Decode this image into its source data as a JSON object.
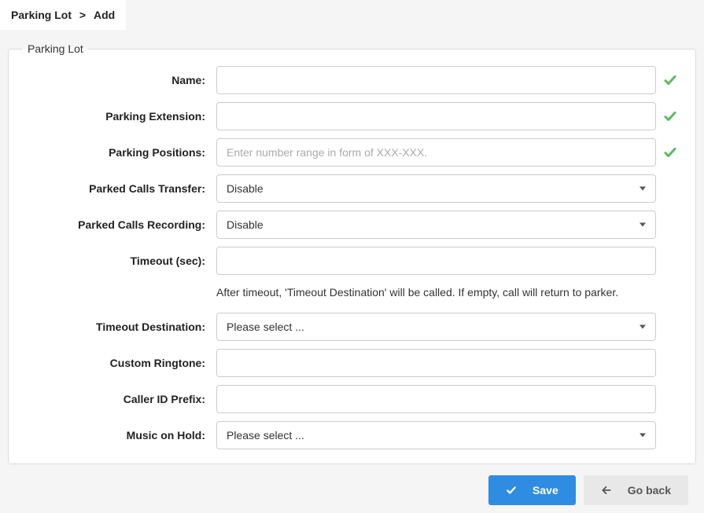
{
  "breadcrumb": {
    "root": "Parking Lot",
    "separator": "❯",
    "leaf": "Add"
  },
  "fieldset": {
    "legend": "Parking Lot"
  },
  "form": {
    "name": {
      "label": "Name:",
      "value": ""
    },
    "parking_extension": {
      "label": "Parking Extension:",
      "value": ""
    },
    "parking_positions": {
      "label": "Parking Positions:",
      "value": "",
      "placeholder": "Enter number range in form of XXX-XXX."
    },
    "parked_calls_transfer": {
      "label": "Parked Calls Transfer:",
      "value": "Disable"
    },
    "parked_calls_recording": {
      "label": "Parked Calls Recording:",
      "value": "Disable"
    },
    "timeout": {
      "label": "Timeout (sec):",
      "value": ""
    },
    "timeout_helper": "After timeout, 'Timeout Destination' will be called. If empty, call will return to parker.",
    "timeout_destination": {
      "label": "Timeout Destination:",
      "value": "Please select ..."
    },
    "custom_ringtone": {
      "label": "Custom Ringtone:",
      "value": ""
    },
    "caller_id_prefix": {
      "label": "Caller ID Prefix:",
      "value": ""
    },
    "music_on_hold": {
      "label": "Music on Hold:",
      "value": "Please select ..."
    }
  },
  "actions": {
    "save": "Save",
    "go_back": "Go back"
  },
  "colors": {
    "primary": "#2f8ce3",
    "success": "#5cb85c",
    "secondary_bg": "#e8e8e8"
  }
}
